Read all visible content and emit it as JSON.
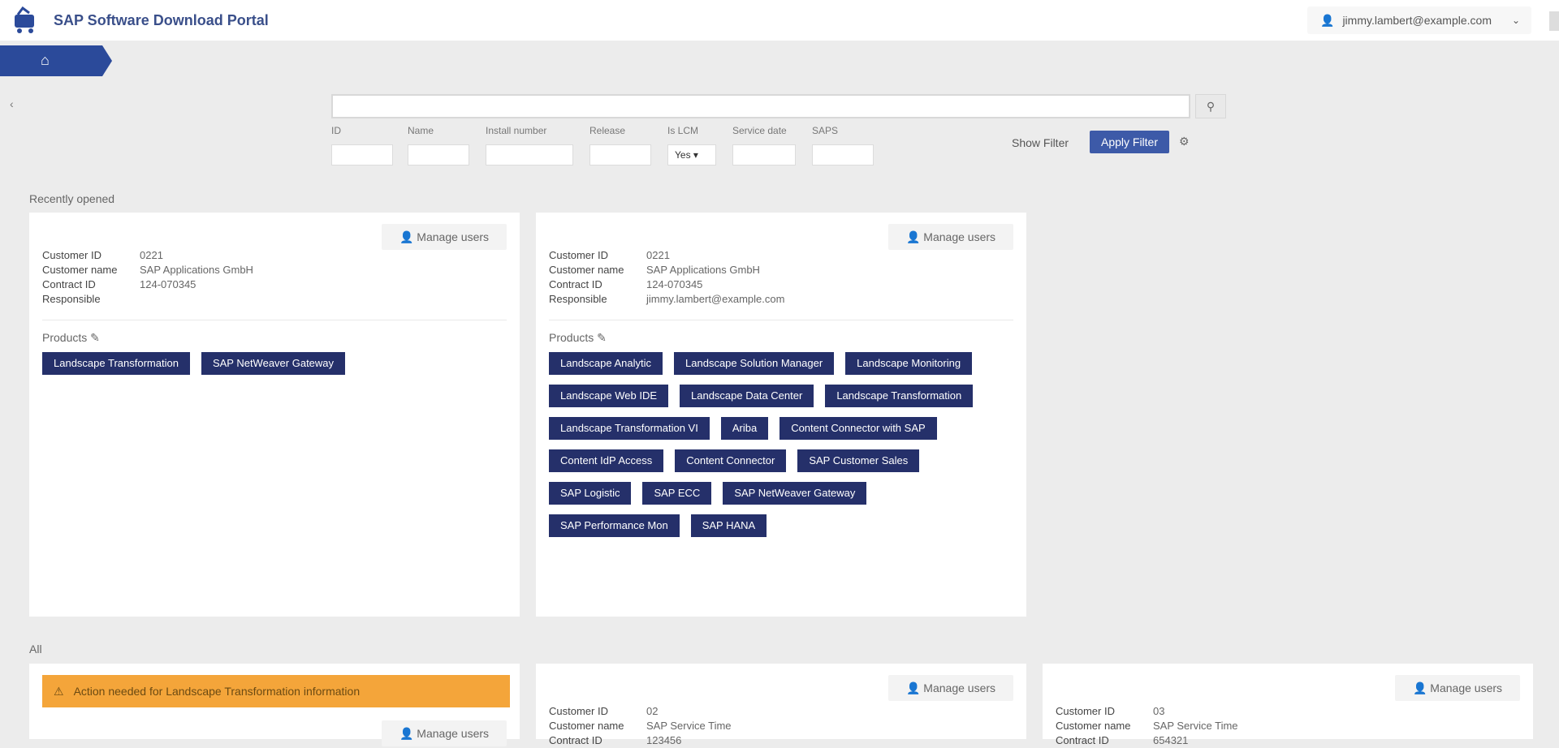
{
  "header": {
    "app_title": "SAP Software Download Portal",
    "user_email": "jimmy.lambert@example.com"
  },
  "search": {
    "value": "",
    "placeholder": ""
  },
  "filters": [
    {
      "label": "ID",
      "value": ""
    },
    {
      "label": "Name",
      "value": ""
    },
    {
      "label": "Install number",
      "value": ""
    },
    {
      "label": "Release",
      "value": ""
    },
    {
      "label": "Is LCM",
      "value": "Yes"
    },
    {
      "label": "Service date",
      "value": ""
    },
    {
      "label": "SAPS",
      "value": ""
    }
  ],
  "toolbar": {
    "show_filter_label": "Show Filter",
    "apply_label": "Apply Filter"
  },
  "sections": {
    "recent_label": "Recently opened",
    "all_label": "All"
  },
  "manage_label": "Manage users",
  "recent_cards": [
    {
      "info": [
        {
          "key": "Customer ID",
          "value": "0221"
        },
        {
          "key": "Customer name",
          "value": "SAP Applications GmbH"
        },
        {
          "key": "Contract ID",
          "value": "124-070345"
        },
        {
          "key": "Responsible",
          "value": ""
        }
      ],
      "products_label": "Products",
      "products": [
        "Landscape Transformation",
        "SAP NetWeaver Gateway"
      ]
    },
    {
      "info": [
        {
          "key": "Customer ID",
          "value": "0221"
        },
        {
          "key": "Customer name",
          "value": "SAP Applications GmbH"
        },
        {
          "key": "Contract ID",
          "value": "124-070345"
        },
        {
          "key": "Responsible",
          "value": "jimmy.lambert@example.com"
        }
      ],
      "products_label": "Products",
      "products": [
        "Landscape Analytic",
        "Landscape Solution Manager",
        "Landscape Monitoring",
        "Landscape Web IDE",
        "Landscape Data Center",
        "Landscape Transformation",
        "Landscape Transformation VI",
        "Ariba",
        "Content Connector with SAP",
        "Content IdP Access",
        "Content Connector",
        "SAP Customer Sales",
        "SAP Logistic",
        "SAP ECC",
        "SAP NetWeaver Gateway",
        "SAP Performance Mon",
        "SAP HANA"
      ]
    }
  ],
  "all_cards": [
    {
      "warning": "Action needed for Landscape Transformation information",
      "info": []
    },
    {
      "info": [
        {
          "key": "Customer ID",
          "value": "02"
        },
        {
          "key": "Customer name",
          "value": "SAP Service Time"
        },
        {
          "key": "Contract ID",
          "value": "123456"
        }
      ]
    },
    {
      "info": [
        {
          "key": "Customer ID",
          "value": "03"
        },
        {
          "key": "Customer name",
          "value": "SAP Service Time"
        },
        {
          "key": "Contract ID",
          "value": "654321"
        }
      ]
    }
  ]
}
